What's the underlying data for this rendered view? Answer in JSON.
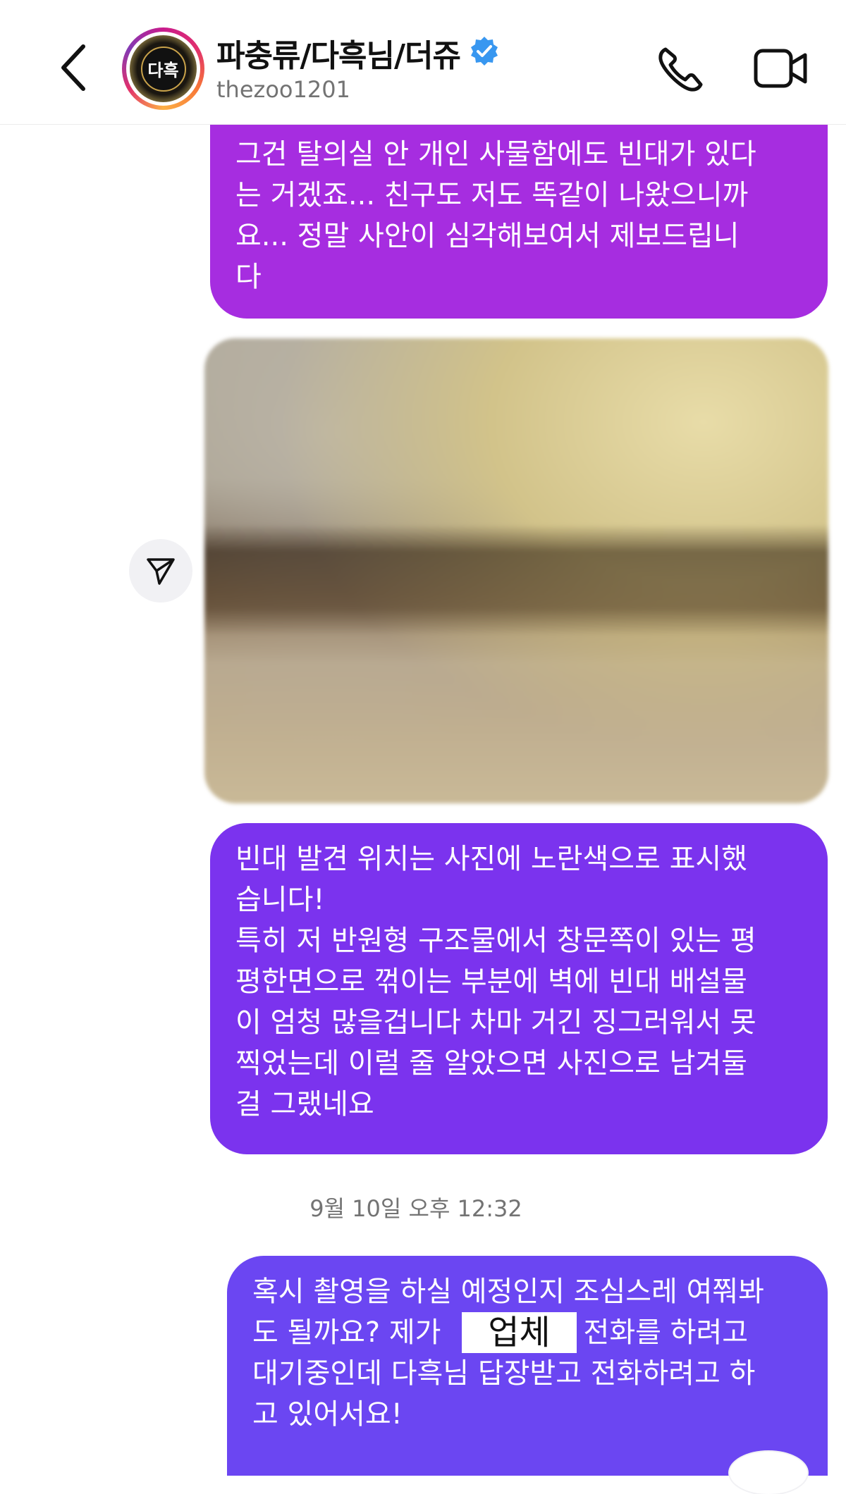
{
  "header": {
    "name": "파충류/다흑님/더쥬",
    "username": "thezoo1201",
    "avatar_text": "다흑",
    "back_icon": "chevron-left-icon",
    "verified_icon": "verified-badge-icon",
    "phone_icon": "phone-icon",
    "video_icon": "video-camera-icon",
    "verified_color": "#3897f0"
  },
  "messages": [
    {
      "type": "text",
      "text": "그건 탈의실 안 개인 사물함에도 빈대가 있다\n는 거겠죠... 친구도 저도 똑같이 나왔으니까\n요... 정말 사안이 심각해보여서 제보드립니\n다",
      "color": "#a62de0"
    },
    {
      "type": "image",
      "share_icon": "share-paper-plane-icon"
    },
    {
      "type": "text",
      "text": "빈대 발견 위치는 사진에 노란색으로 표시했\n습니다!\n특히 저 반원형 구조물에서 창문쪽이 있는 평\n평한면으로 꺾이는 부분에 벽에 빈대 배설물\n이 엄청 많을겁니다 차마 거긴 징그러워서 못\n찍었는데 이럴 줄 알았으면 사진으로 남겨둘\n걸 그랬네요",
      "color": "#7b33ee"
    },
    {
      "type": "timestamp",
      "text": "9월 10일 오후 12:32"
    },
    {
      "type": "text",
      "text": "혹시 촬영을 하실 예정인지 조심스레 여쭤봐\n도 될까요? 제가            랑 전화를 하려고\n대기중인데 다흑님 답장받고 전화하려고 하\n고 있어서요!",
      "redaction_label": "업체",
      "color": "#6b46f2"
    }
  ]
}
